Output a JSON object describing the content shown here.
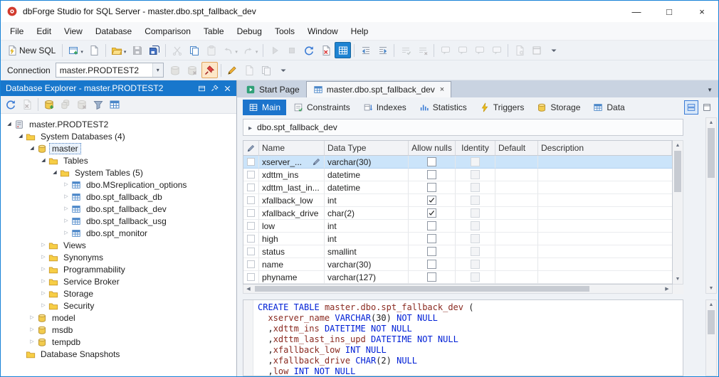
{
  "window": {
    "title": "dbForge Studio for SQL Server - master.dbo.spt_fallback_dev",
    "controls": {
      "minimize": "—",
      "maximize": "□",
      "close": "×"
    }
  },
  "menu": {
    "items": [
      "File",
      "Edit",
      "View",
      "Database",
      "Comparison",
      "Table",
      "Debug",
      "Tools",
      "Window",
      "Help"
    ]
  },
  "toolbars": {
    "main": [
      {
        "name": "new-sql",
        "label": "New SQL",
        "icon": "sql-doc"
      },
      {
        "name": "sep"
      },
      {
        "name": "new-query-window",
        "icon": "window-new",
        "arrow": true
      },
      {
        "name": "new-document",
        "icon": "doc-new"
      },
      {
        "name": "sep"
      },
      {
        "name": "open-file",
        "icon": "folder-open",
        "arrow": true
      },
      {
        "name": "save",
        "icon": "floppy",
        "state": "disabled"
      },
      {
        "name": "save-all",
        "icon": "floppy-all"
      },
      {
        "name": "sep"
      },
      {
        "name": "cut",
        "icon": "scissors",
        "state": "disabled"
      },
      {
        "name": "copy",
        "icon": "copy"
      },
      {
        "name": "paste",
        "icon": "clipboard",
        "state": "disabled"
      },
      {
        "name": "undo",
        "icon": "undo",
        "state": "disabled",
        "arrow": true
      },
      {
        "name": "redo",
        "icon": "redo",
        "state": "disabled",
        "arrow": true
      },
      {
        "name": "sep"
      },
      {
        "name": "execute",
        "icon": "play-doc",
        "state": "disabled"
      },
      {
        "name": "stop-execution",
        "icon": "stop-doc",
        "state": "disabled"
      },
      {
        "name": "refresh-object",
        "icon": "refresh"
      },
      {
        "name": "cancel-refresh",
        "icon": "doc-x"
      },
      {
        "name": "sql-editor-toggle",
        "icon": "sql-grid",
        "state": "active-blue"
      },
      {
        "name": "sep"
      },
      {
        "name": "indent-decrease",
        "icon": "indent-left"
      },
      {
        "name": "indent-increase",
        "icon": "indent-right"
      },
      {
        "name": "sep"
      },
      {
        "name": "comment-lines",
        "icon": "comment",
        "state": "disabled"
      },
      {
        "name": "uncomment-lines",
        "icon": "uncomment",
        "state": "disabled"
      },
      {
        "name": "sep"
      },
      {
        "name": "bookmark-toggle",
        "icon": "bubble",
        "state": "disabled"
      },
      {
        "name": "bookmark-previous",
        "icon": "bubble",
        "state": "disabled"
      },
      {
        "name": "bookmark-next",
        "icon": "bubble",
        "state": "disabled"
      },
      {
        "name": "bookmark-clear",
        "icon": "bubble",
        "state": "disabled"
      },
      {
        "name": "sep"
      },
      {
        "name": "layout-document",
        "icon": "doc-gear",
        "state": "disabled"
      },
      {
        "name": "layout-window",
        "icon": "maximize",
        "state": "disabled"
      },
      {
        "name": "toolbar-overflow",
        "icon": "chevron-down"
      }
    ],
    "connection": [
      {
        "name": "new-connection",
        "icon": "db",
        "state": "disabled"
      },
      {
        "name": "disconnect",
        "icon": "db-x",
        "state": "disabled"
      },
      {
        "name": "pin-connection",
        "icon": "pin",
        "state": "active-warm"
      },
      {
        "name": "sep"
      },
      {
        "name": "edit-object",
        "icon": "pencil"
      },
      {
        "name": "script-object",
        "icon": "doc-new",
        "state": "disabled"
      },
      {
        "name": "duplicate-document",
        "icon": "copy",
        "state": "disabled"
      },
      {
        "name": "connection-overflow",
        "icon": "chevron-down"
      }
    ],
    "explorer": [
      {
        "name": "refresh-explorer",
        "icon": "refresh"
      },
      {
        "name": "stop-refresh",
        "icon": "doc-x",
        "state": "disabled"
      },
      {
        "name": "sep"
      },
      {
        "name": "new-database",
        "icon": "db-plus"
      },
      {
        "name": "duplicate-object",
        "icon": "db-copy",
        "state": "disabled"
      },
      {
        "name": "delete-object",
        "icon": "db-x",
        "state": "disabled"
      },
      {
        "name": "filter-objects",
        "icon": "funnel"
      },
      {
        "name": "object-viewer",
        "icon": "table"
      }
    ]
  },
  "connection": {
    "label": "Connection",
    "value": "master.PRODTEST2"
  },
  "explorer": {
    "title": "Database Explorer - master.PRODTEST2",
    "tree": [
      {
        "indent": 0,
        "expander": "open",
        "icon": "server",
        "label": "master.PRODTEST2"
      },
      {
        "indent": 1,
        "expander": "open",
        "icon": "folder",
        "label": "System Databases (4)"
      },
      {
        "indent": 2,
        "expander": "open",
        "icon": "db",
        "label": "master",
        "focused": true
      },
      {
        "indent": 3,
        "expander": "open",
        "icon": "folder",
        "label": "Tables"
      },
      {
        "indent": 4,
        "expander": "open",
        "icon": "folder",
        "label": "System Tables (5)"
      },
      {
        "indent": 5,
        "expander": "closed",
        "icon": "table",
        "label": "dbo.MSreplication_options"
      },
      {
        "indent": 5,
        "expander": "closed",
        "icon": "table",
        "label": "dbo.spt_fallback_db"
      },
      {
        "indent": 5,
        "expander": "closed",
        "icon": "table",
        "label": "dbo.spt_fallback_dev"
      },
      {
        "indent": 5,
        "expander": "closed",
        "icon": "table",
        "label": "dbo.spt_fallback_usg"
      },
      {
        "indent": 5,
        "expander": "closed",
        "icon": "table",
        "label": "dbo.spt_monitor"
      },
      {
        "indent": 3,
        "expander": "closed",
        "icon": "folder",
        "label": "Views"
      },
      {
        "indent": 3,
        "expander": "closed",
        "icon": "folder",
        "label": "Synonyms"
      },
      {
        "indent": 3,
        "expander": "closed",
        "icon": "folder",
        "label": "Programmability"
      },
      {
        "indent": 3,
        "expander": "closed",
        "icon": "folder",
        "label": "Service Broker"
      },
      {
        "indent": 3,
        "expander": "closed",
        "icon": "folder",
        "label": "Storage"
      },
      {
        "indent": 3,
        "expander": "closed",
        "icon": "folder",
        "label": "Security"
      },
      {
        "indent": 2,
        "expander": "closed",
        "icon": "db",
        "label": "model"
      },
      {
        "indent": 2,
        "expander": "closed",
        "icon": "db",
        "label": "msdb"
      },
      {
        "indent": 2,
        "expander": "closed",
        "icon": "db",
        "label": "tempdb"
      },
      {
        "indent": 1,
        "expander": "none",
        "icon": "folder",
        "label": "Database Snapshots"
      }
    ]
  },
  "doc_tabs": {
    "items": [
      {
        "name": "tab-start-page",
        "label": "Start Page",
        "icon": "start-page",
        "active": false
      },
      {
        "name": "tab-table-editor",
        "label": "master.dbo.spt_fallback_dev",
        "icon": "table",
        "active": true,
        "close": "×"
      }
    ]
  },
  "editor": {
    "tabs": [
      {
        "name": "tab-main",
        "label": "Main",
        "icon": "grid-white",
        "active": true
      },
      {
        "name": "tab-constraints",
        "label": "Constraints",
        "icon": "constraints"
      },
      {
        "name": "tab-indexes",
        "label": "Indexes",
        "icon": "indexes"
      },
      {
        "name": "tab-statistics",
        "label": "Statistics",
        "icon": "stats"
      },
      {
        "name": "tab-triggers",
        "label": "Triggers",
        "icon": "lightning"
      },
      {
        "name": "tab-storage",
        "label": "Storage",
        "icon": "db"
      },
      {
        "name": "tab-data",
        "label": "Data",
        "icon": "table"
      }
    ],
    "view_buttons": [
      {
        "name": "split-view",
        "icon": "split-h",
        "active": true
      },
      {
        "name": "full-view",
        "icon": "maximize",
        "active": false
      }
    ],
    "breadcrumb": "dbo.spt_fallback_dev",
    "grid": {
      "columns": [
        "Name",
        "Data Type",
        "Allow nulls",
        "Identity",
        "Default",
        "Description"
      ],
      "rows": [
        {
          "name": "xserver_...",
          "datatype": "varchar(30)",
          "nulls": false,
          "selected": true,
          "editing": true
        },
        {
          "name": "xdttm_ins",
          "datatype": "datetime",
          "nulls": false
        },
        {
          "name": "xdttm_last_in...",
          "datatype": "datetime",
          "nulls": false
        },
        {
          "name": "xfallback_low",
          "datatype": "int",
          "nulls": true
        },
        {
          "name": "xfallback_drive",
          "datatype": "char(2)",
          "nulls": true
        },
        {
          "name": "low",
          "datatype": "int",
          "nulls": false
        },
        {
          "name": "high",
          "datatype": "int",
          "nulls": false
        },
        {
          "name": "status",
          "datatype": "smallint",
          "nulls": false
        },
        {
          "name": "name",
          "datatype": "varchar(30)",
          "nulls": false
        },
        {
          "name": "phyname",
          "datatype": "varchar(127)",
          "nulls": false
        }
      ]
    },
    "sql": {
      "lines": [
        [
          [
            "k",
            "CREATE TABLE"
          ],
          [
            "p",
            " "
          ],
          [
            "i",
            "master.dbo.spt_fallback_dev"
          ],
          [
            "p",
            " ("
          ]
        ],
        [
          [
            "p",
            "  "
          ],
          [
            "i",
            "xserver_name"
          ],
          [
            "p",
            " "
          ],
          [
            "k",
            "VARCHAR"
          ],
          [
            "p",
            "(30) "
          ],
          [
            "k",
            "NOT NULL"
          ]
        ],
        [
          [
            "p",
            "  ,"
          ],
          [
            "i",
            "xdttm_ins"
          ],
          [
            "p",
            " "
          ],
          [
            "k",
            "DATETIME"
          ],
          [
            "p",
            " "
          ],
          [
            "k",
            "NOT NULL"
          ]
        ],
        [
          [
            "p",
            "  ,"
          ],
          [
            "i",
            "xdttm_last_ins_upd"
          ],
          [
            "p",
            " "
          ],
          [
            "k",
            "DATETIME"
          ],
          [
            "p",
            " "
          ],
          [
            "k",
            "NOT NULL"
          ]
        ],
        [
          [
            "p",
            "  ,"
          ],
          [
            "i",
            "xfallback_low"
          ],
          [
            "p",
            " "
          ],
          [
            "k",
            "INT"
          ],
          [
            "p",
            " "
          ],
          [
            "k",
            "NULL"
          ]
        ],
        [
          [
            "p",
            "  ,"
          ],
          [
            "i",
            "xfallback_drive"
          ],
          [
            "p",
            " "
          ],
          [
            "k",
            "CHAR"
          ],
          [
            "p",
            "(2) "
          ],
          [
            "k",
            "NULL"
          ]
        ],
        [
          [
            "p",
            "  ,"
          ],
          [
            "i",
            "low"
          ],
          [
            "p",
            " "
          ],
          [
            "k",
            "INT"
          ],
          [
            "p",
            " "
          ],
          [
            "k",
            "NOT NULL"
          ]
        ]
      ]
    }
  }
}
